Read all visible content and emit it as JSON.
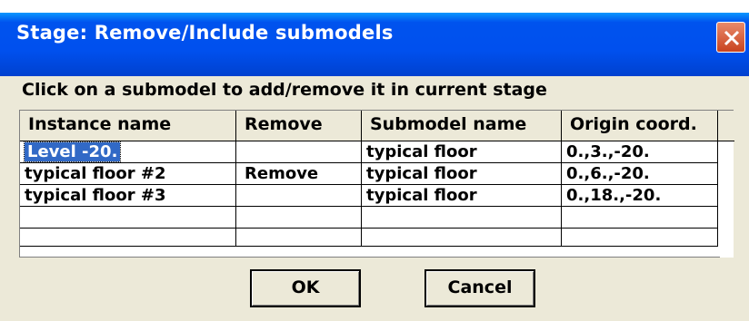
{
  "window": {
    "title": "Stage: Remove/Include submodels",
    "close_icon": "close-icon",
    "titlebar_color": "#0054e3"
  },
  "instruction": "Click on a submodel to add/remove it in current stage",
  "grid": {
    "columns": [
      "Instance name",
      "Remove",
      "Submodel name",
      "Origin coord."
    ],
    "rows": [
      {
        "instance": "Level -20.",
        "remove": "",
        "submodel": "typical floor",
        "origin": "0.,3.,-20."
      },
      {
        "instance": "typical floor #2",
        "remove": "Remove",
        "submodel": "typical floor",
        "origin": "0.,6.,-20."
      },
      {
        "instance": "typical floor #3",
        "remove": "",
        "submodel": "typical floor",
        "origin": "0.,18.,-20."
      },
      {
        "instance": "",
        "remove": "",
        "submodel": "",
        "origin": ""
      },
      {
        "instance": "",
        "remove": "",
        "submodel": "",
        "origin": ""
      }
    ],
    "selected_color": "#3169c6"
  },
  "buttons": {
    "ok": "OK",
    "cancel": "Cancel"
  }
}
